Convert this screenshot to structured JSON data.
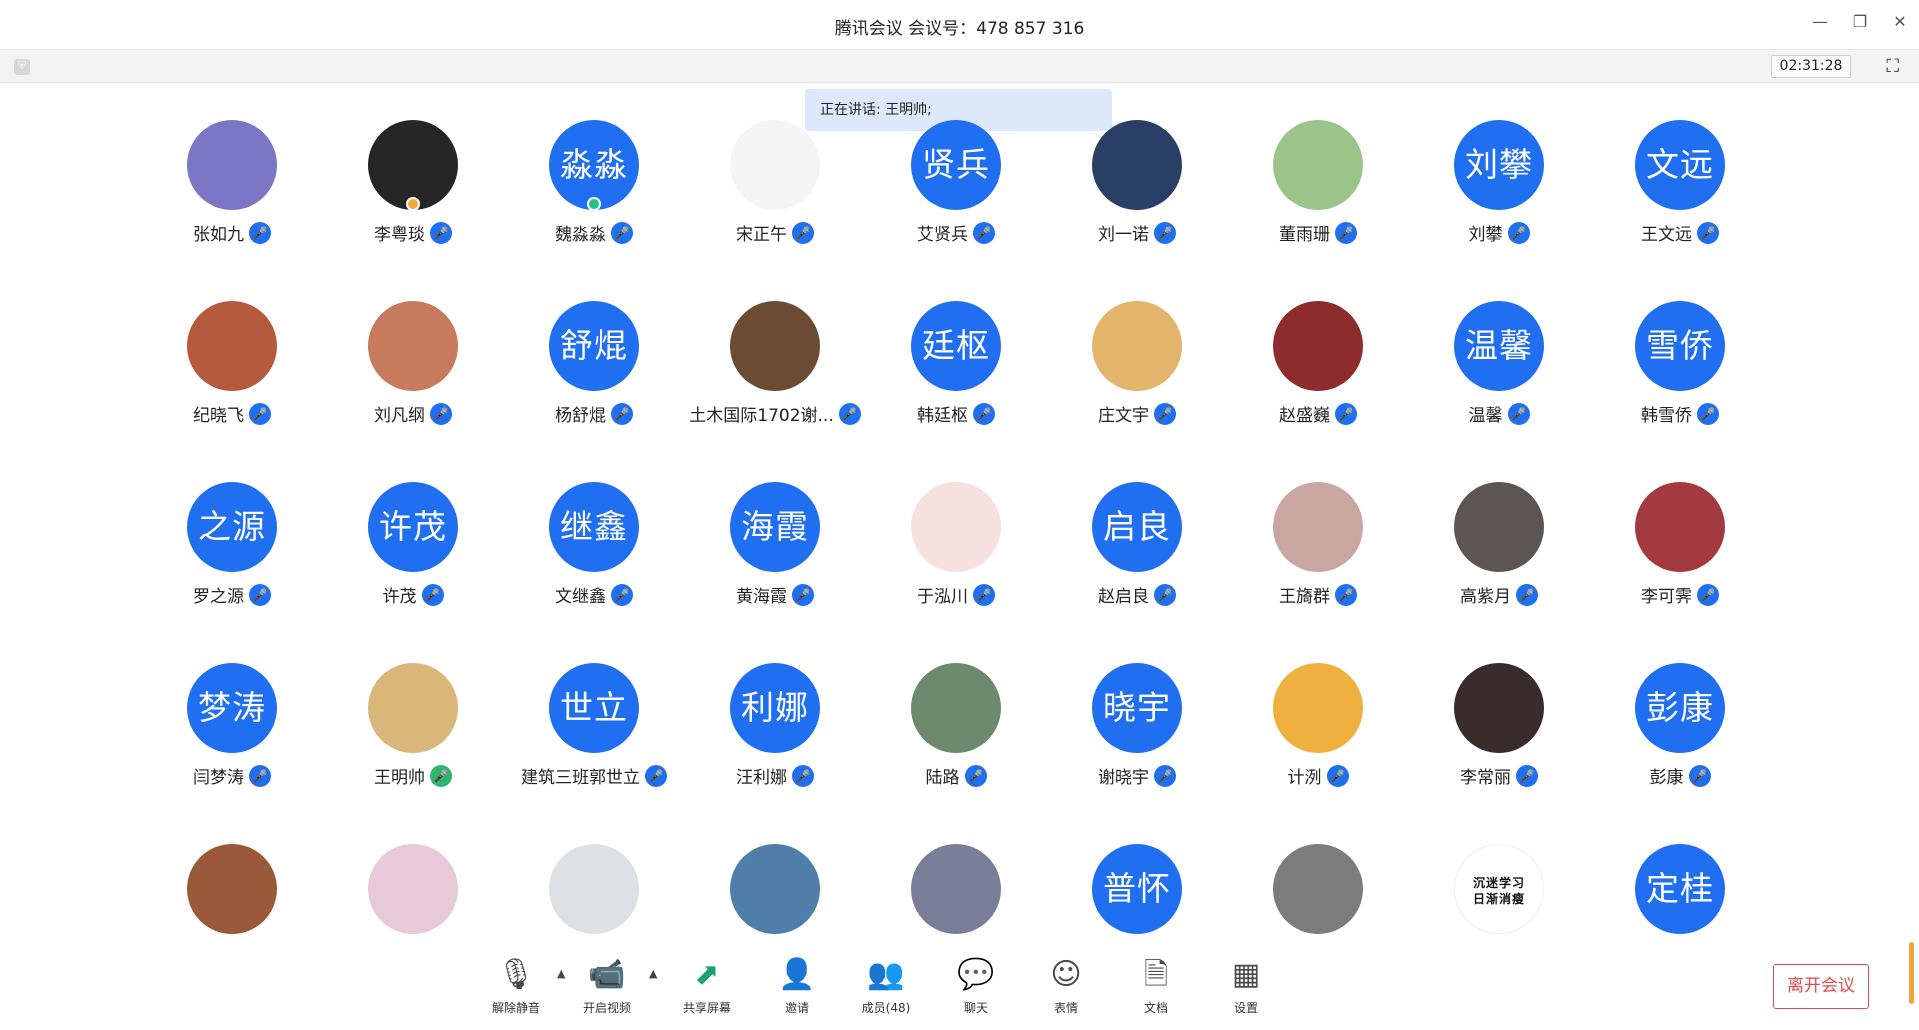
{
  "window": {
    "title": "腾讯会议 会议号：478 857 316",
    "timer": "02:31:28",
    "minimize_icon": "minimize-icon",
    "restore_icon": "restore-icon",
    "close_icon": "close-icon"
  },
  "speaking": {
    "text": "正在讲话: 王明帅;"
  },
  "participants": [
    {
      "name": "张如九",
      "avatar_text": "",
      "mic": "blue"
    },
    {
      "name": "李粤琰",
      "avatar_text": "",
      "mic": "blue",
      "badge": "orange"
    },
    {
      "name": "魏淼淼",
      "avatar_text": "淼淼",
      "mic": "blue",
      "badge": "teal"
    },
    {
      "name": "宋正午",
      "avatar_text": "",
      "mic": "blue"
    },
    {
      "name": "艾贤兵",
      "avatar_text": "贤兵",
      "mic": "blue"
    },
    {
      "name": "刘一诺",
      "avatar_text": "",
      "mic": "blue"
    },
    {
      "name": "董雨珊",
      "avatar_text": "",
      "mic": "blue"
    },
    {
      "name": "刘攀",
      "avatar_text": "刘攀",
      "mic": "blue"
    },
    {
      "name": "王文远",
      "avatar_text": "文远",
      "mic": "blue"
    },
    {
      "name": "纪晓飞",
      "avatar_text": "",
      "mic": "blue"
    },
    {
      "name": "刘凡纲",
      "avatar_text": "",
      "mic": "blue"
    },
    {
      "name": "杨舒焜",
      "avatar_text": "舒焜",
      "mic": "blue"
    },
    {
      "name": "土木国际1702谢...",
      "avatar_text": "",
      "mic": "blue"
    },
    {
      "name": "韩廷枢",
      "avatar_text": "廷枢",
      "mic": "blue"
    },
    {
      "name": "庄文宇",
      "avatar_text": "",
      "mic": "blue"
    },
    {
      "name": "赵盛巍",
      "avatar_text": "",
      "mic": "blue"
    },
    {
      "name": "温馨",
      "avatar_text": "温馨",
      "mic": "blue"
    },
    {
      "name": "韩雪侨",
      "avatar_text": "雪侨",
      "mic": "blue"
    },
    {
      "name": "罗之源",
      "avatar_text": "之源",
      "mic": "none"
    },
    {
      "name": "许茂",
      "avatar_text": "许茂",
      "mic": "blue"
    },
    {
      "name": "文继鑫",
      "avatar_text": "继鑫",
      "mic": "blue"
    },
    {
      "name": "黄海霞",
      "avatar_text": "海霞",
      "mic": "blue"
    },
    {
      "name": "于泓川",
      "avatar_text": "",
      "mic": "blue"
    },
    {
      "name": "赵启良",
      "avatar_text": "启良",
      "mic": "blue"
    },
    {
      "name": "王旖群",
      "avatar_text": "",
      "mic": "blue"
    },
    {
      "name": "高紫月",
      "avatar_text": "",
      "mic": "blue"
    },
    {
      "name": "李可霁",
      "avatar_text": "",
      "mic": "blue"
    },
    {
      "name": "闫梦涛",
      "avatar_text": "梦涛",
      "mic": "blue"
    },
    {
      "name": "王明帅",
      "avatar_text": "",
      "mic": "green"
    },
    {
      "name": "建筑三班郭世立",
      "avatar_text": "世立",
      "mic": "blue"
    },
    {
      "name": "汪利娜",
      "avatar_text": "利娜",
      "mic": "blue"
    },
    {
      "name": "陆路",
      "avatar_text": "",
      "mic": "blue"
    },
    {
      "name": "谢晓宇",
      "avatar_text": "晓宇",
      "mic": "blue"
    },
    {
      "name": "计洌",
      "avatar_text": "",
      "mic": "blue"
    },
    {
      "name": "李常丽",
      "avatar_text": "",
      "mic": "blue"
    },
    {
      "name": "彭康",
      "avatar_text": "彭康",
      "mic": "blue"
    },
    {
      "name": "",
      "avatar_text": "",
      "mic": "none"
    },
    {
      "name": "",
      "avatar_text": "",
      "mic": "none"
    },
    {
      "name": "",
      "avatar_text": "",
      "mic": "none"
    },
    {
      "name": "",
      "avatar_text": "",
      "mic": "none"
    },
    {
      "name": "",
      "avatar_text": "",
      "mic": "none"
    },
    {
      "name": "",
      "avatar_text": "普怀",
      "mic": "none"
    },
    {
      "name": "",
      "avatar_text": "",
      "mic": "none"
    },
    {
      "name": "",
      "avatar_text": "沉迷学习\n日渐消瘦",
      "mic": "none"
    },
    {
      "name": "",
      "avatar_text": "定桂",
      "mic": "none"
    }
  ],
  "avatar_pic_colors": [
    "#7a78c4",
    "#262626",
    "",
    "#f5f5f5",
    "",
    "#2a3f66",
    "#9bc48b",
    "",
    "",
    "#b55a3c",
    "#c87a5c",
    "",
    "#6b4b33",
    "",
    "#e3b46b",
    "#8c2c2c",
    "",
    "",
    "",
    "",
    "",
    "",
    "#f7e1df",
    "",
    "#c9a6a0",
    "#5b5555",
    "#a33a40",
    "",
    "#d9b77a",
    "",
    "",
    "#6d8a6f",
    "",
    "#f0b040",
    "#3a2c2c",
    "",
    "#9a5a3a",
    "#e8c9d8",
    "#dfe0e4",
    "#4f7fa8",
    "#7a7f99",
    "",
    "#7c7c7c",
    "#ffffff",
    ""
  ],
  "toolbar": {
    "unmute": "解除静音",
    "video": "开启视频",
    "share": "共享屏幕",
    "invite": "邀请",
    "members": "成员(48)",
    "chat": "聊天",
    "emoji": "表情",
    "docs": "文档",
    "settings": "设置",
    "leave": "离开会议"
  },
  "colors": {
    "accent": "#1f6ff0",
    "leave": "#e64b4b",
    "speaking_bg": "#dde8fa"
  }
}
